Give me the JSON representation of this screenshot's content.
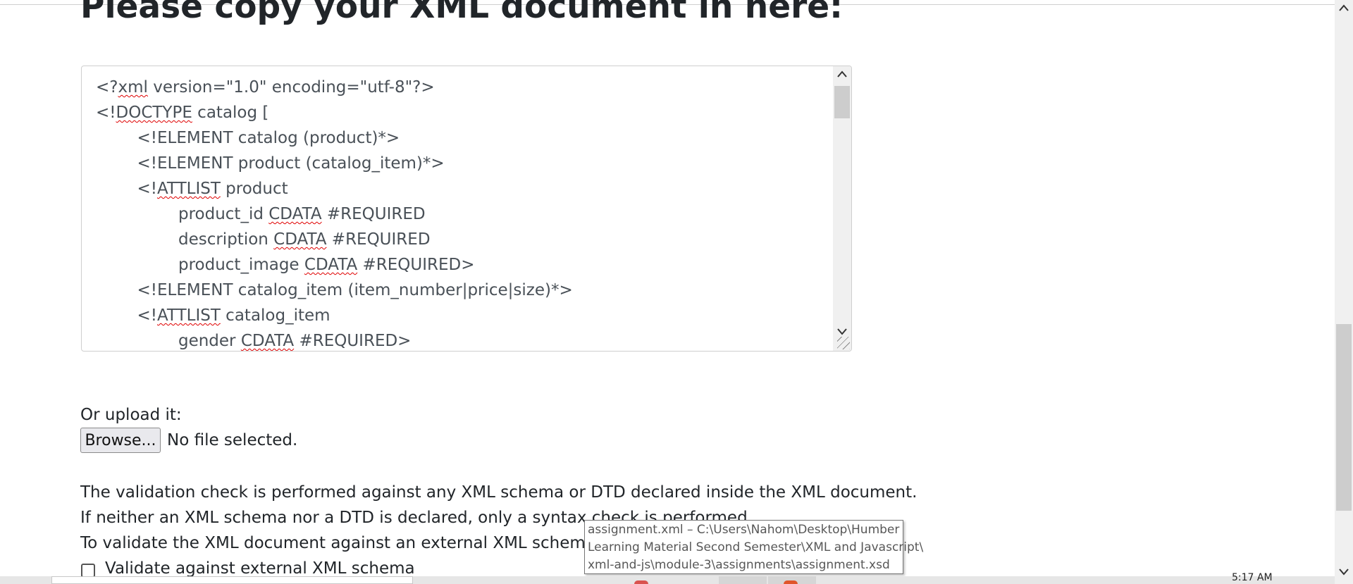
{
  "page": {
    "title": "Please copy your XML document in here:"
  },
  "editor": {
    "lines": [
      [
        {
          "t": "<?"
        },
        {
          "t": "xml",
          "s": true
        },
        {
          "t": " version=\"1.0\" encoding=\"utf-8\"?>"
        }
      ],
      [
        {
          "t": "<!"
        },
        {
          "t": "DOCTYPE",
          "s": true
        },
        {
          "t": " catalog ["
        }
      ],
      [
        {
          "t": "        <!ELEMENT catalog (product)*>"
        }
      ],
      [
        {
          "t": "        <!ELEMENT product (catalog_item)*>"
        }
      ],
      [
        {
          "t": "        <!"
        },
        {
          "t": "ATTLIST",
          "s": true
        },
        {
          "t": " product"
        }
      ],
      [
        {
          "t": "                product_id "
        },
        {
          "t": "CDATA",
          "s": true
        },
        {
          "t": " #REQUIRED"
        }
      ],
      [
        {
          "t": "                description "
        },
        {
          "t": "CDATA",
          "s": true
        },
        {
          "t": " #REQUIRED"
        }
      ],
      [
        {
          "t": "                product_image "
        },
        {
          "t": "CDATA",
          "s": true
        },
        {
          "t": " #REQUIRED>"
        }
      ],
      [
        {
          "t": "        <!ELEMENT catalog_item (item_number|price|size)*>"
        }
      ],
      [
        {
          "t": "        <!"
        },
        {
          "t": "ATTLIST",
          "s": true
        },
        {
          "t": " catalog_item"
        }
      ],
      [
        {
          "t": "                gender "
        },
        {
          "t": "CDATA",
          "s": true
        },
        {
          "t": " #REQUIRED>"
        }
      ]
    ]
  },
  "upload": {
    "label": "Or upload it:",
    "browse_label": "Browse...",
    "file_status": "No file selected."
  },
  "info": {
    "line1": "The validation check is performed against any XML schema or DTD declared inside the XML document.",
    "line2": "If neither an XML schema nor a DTD is declared, only a syntax check is performed.",
    "line3": "To validate the XML document against an external XML schema, click below."
  },
  "external_schema": {
    "checkbox_label": "Validate against external XML schema",
    "checked": false
  },
  "tooltip": {
    "lines": [
      "assignment.xml – C:\\Users\\Nahom\\Desktop\\Humber",
      "Learning Material Second Semester\\XML and Javascript\\",
      "xml-and-js\\module-3\\assignments\\assignment.xsd"
    ]
  },
  "taskbar": {
    "clock": "5:17 AM"
  },
  "icons": {
    "scroll_up": "▲",
    "scroll_down": "▼"
  }
}
